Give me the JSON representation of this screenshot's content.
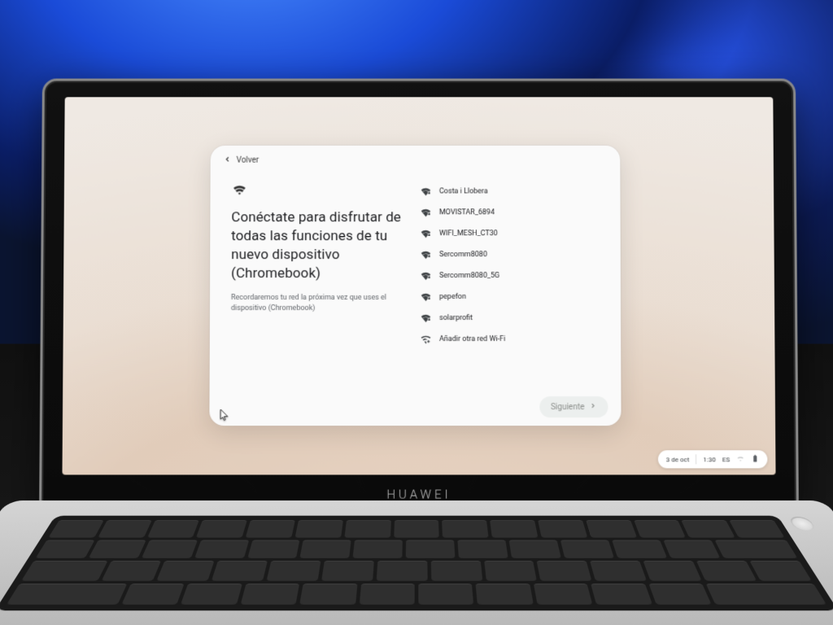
{
  "back_label": "Volver",
  "title": "Conéctate para disfrutar de todas las funciones de tu nuevo dispositivo (Chromebook)",
  "subtitle": "Recordaremos tu red la próxima vez que uses el dispositivo (Chromebook)",
  "networks": [
    {
      "ssid": "Costa i Llobera",
      "secured": true
    },
    {
      "ssid": "MOVISTAR_6894",
      "secured": true
    },
    {
      "ssid": "WIFI_MESH_CT30",
      "secured": true
    },
    {
      "ssid": "Sercomm8080",
      "secured": true
    },
    {
      "ssid": "Sercomm8080_5G",
      "secured": true
    },
    {
      "ssid": "pepefon",
      "secured": true
    },
    {
      "ssid": "solarprofit",
      "secured": true
    }
  ],
  "add_network_label": "Añadir otra red Wi-Fi",
  "next_label": "Siguiente",
  "shelf": {
    "date": "3 de oct",
    "time": "1:30",
    "locale": "ES"
  },
  "laptop_brand": "HUAWEI"
}
